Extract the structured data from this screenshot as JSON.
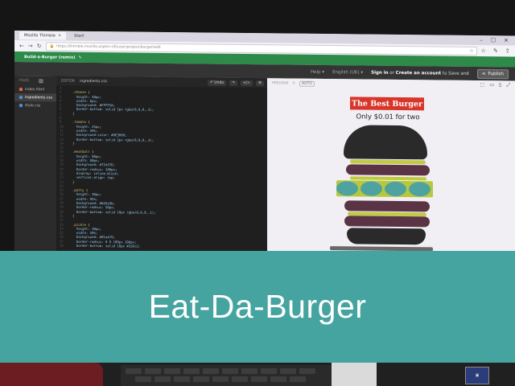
{
  "browser": {
    "tabs": [
      {
        "label": "Mozilla Thimble",
        "active": true
      },
      {
        "label": "Start",
        "active": false
      }
    ],
    "address": "https://thimble.mozilla.org/en-US/user/project/burger/edit",
    "window_controls": [
      "–",
      "☐",
      "✕"
    ]
  },
  "site": {
    "project_title": "Build-a-Burger (remix)"
  },
  "toolbar": {
    "help": "Help ▾",
    "language": "English (UK) ▾",
    "sign_in": "Sign in",
    "or_text": "or",
    "create_account": "Create an account",
    "to_save_text": "to Save and",
    "publish": "Publish"
  },
  "files": {
    "header": "FILES",
    "items": [
      {
        "label": "index.html",
        "color": "#e2683c"
      },
      {
        "label": "ingredients.css",
        "color": "#4a90d9"
      },
      {
        "label": "style.css",
        "color": "#4a90d9"
      }
    ]
  },
  "editor": {
    "header": "EDITOR",
    "filename": "ingredients.css",
    "undo": "↶ Undo",
    "code_lines": [
      {
        "n": "1",
        "t": ""
      },
      {
        "n": "2",
        "t": ".cheese {",
        "k": "sel"
      },
      {
        "n": "3",
        "t": "  height: 50px;",
        "k": "prop"
      },
      {
        "n": "4",
        "t": "  width: 6px;",
        "k": "prop"
      },
      {
        "n": "5",
        "t": "  background: #FFFF5A;",
        "k": "prop"
      },
      {
        "n": "6",
        "t": "  border-bottom: solid 2px rgba(0,0,0,.3);",
        "k": "prop"
      },
      {
        "n": "7",
        "t": "}",
        "k": "sel"
      },
      {
        "n": "8",
        "t": ""
      },
      {
        "n": "9",
        "t": ".tomato {",
        "k": "sel"
      },
      {
        "n": "10",
        "t": "  height: 25px;",
        "k": "prop"
      },
      {
        "n": "11",
        "t": "  width: 20%;",
        "k": "prop"
      },
      {
        "n": "12",
        "t": "  background-color: #DE3000;",
        "k": "prop"
      },
      {
        "n": "13",
        "t": "  border-bottom: solid 2px rgba(0,0,0,.3);",
        "k": "prop"
      },
      {
        "n": "14",
        "t": "}",
        "k": "sel"
      },
      {
        "n": "15",
        "t": ""
      },
      {
        "n": "16",
        "t": ".meatball {",
        "k": "sel"
      },
      {
        "n": "17",
        "t": "  height: 80px;",
        "k": "prop"
      },
      {
        "n": "18",
        "t": "  width: 80px;",
        "k": "prop"
      },
      {
        "n": "19",
        "t": "  background: #72a37D;",
        "k": "prop"
      },
      {
        "n": "20",
        "t": "  border-radius: 100px;",
        "k": "prop"
      },
      {
        "n": "21",
        "t": "  display: inline-block;",
        "k": "prop"
      },
      {
        "n": "22",
        "t": "  vertical-align: top;",
        "k": "prop"
      },
      {
        "n": "23",
        "t": "}",
        "k": "sel"
      },
      {
        "n": "24",
        "t": ""
      },
      {
        "n": "25",
        "t": ".patty {",
        "k": "sel"
      },
      {
        "n": "26",
        "t": "  height: 30px;",
        "k": "prop"
      },
      {
        "n": "27",
        "t": "  width: 95%;",
        "k": "prop"
      },
      {
        "n": "28",
        "t": "  background: #6d3a3b;",
        "k": "prop"
      },
      {
        "n": "29",
        "t": "  border-radius: 50px;",
        "k": "prop"
      },
      {
        "n": "30",
        "t": "  border-bottom: solid 10px rgba(0,0,0,.1);",
        "k": "prop"
      },
      {
        "n": "31",
        "t": "}",
        "k": "sel"
      },
      {
        "n": "32",
        "t": ""
      },
      {
        "n": "33",
        "t": ".pickle {",
        "k": "sel"
      },
      {
        "n": "34",
        "t": "  height: 30px;",
        "k": "prop"
      },
      {
        "n": "35",
        "t": "  width: 50%;",
        "k": "prop"
      },
      {
        "n": "36",
        "t": "  background: #91a470;",
        "k": "prop"
      },
      {
        "n": "37",
        "t": "  border-radius: 0 0 100px 100px;",
        "k": "prop"
      },
      {
        "n": "38",
        "t": "  border-bottom: solid 10px #2d3c2;",
        "k": "prop"
      }
    ]
  },
  "preview": {
    "header": "PREVIEW",
    "auto": "AUTO",
    "heading": "The Best Burger",
    "price": "Only $0.01 for two"
  },
  "banner": {
    "title": "Eat-Da-Burger",
    "color": "#45a4a0"
  }
}
